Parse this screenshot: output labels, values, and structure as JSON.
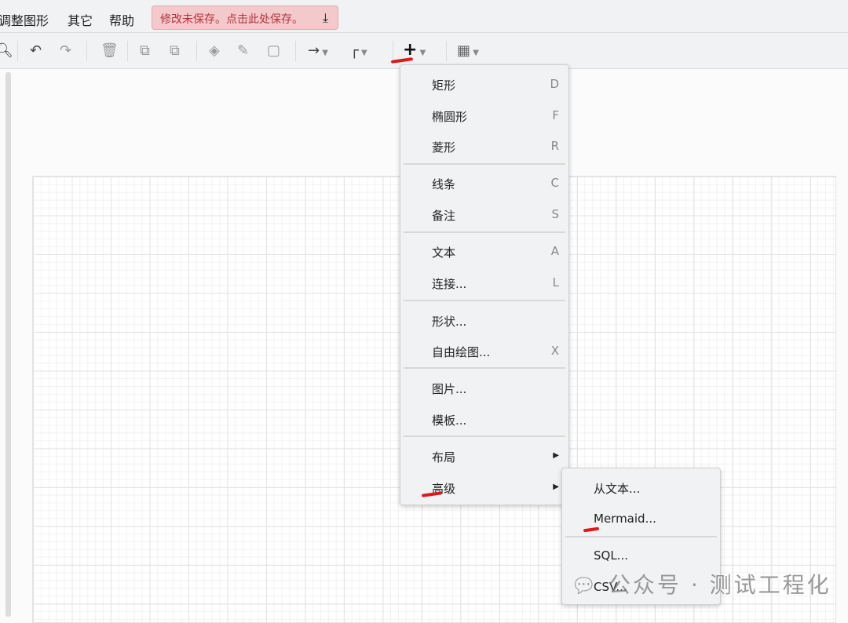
{
  "menubar": {
    "items": [
      "调整图形",
      "其它",
      "帮助"
    ],
    "save_notice": "修改未保存。点击此处保存。"
  },
  "toolbar": {
    "icons": [
      "zoom-out",
      "undo",
      "redo",
      "delete",
      "to-front",
      "to-back",
      "fill-color",
      "line-color",
      "shadow",
      "connection",
      "waypoints",
      "insert",
      "table"
    ]
  },
  "insert_menu": {
    "groups": [
      [
        {
          "label": "矩形",
          "key": "D"
        },
        {
          "label": "椭圆形",
          "key": "F"
        },
        {
          "label": "菱形",
          "key": "R"
        }
      ],
      [
        {
          "label": "线条",
          "key": "C"
        },
        {
          "label": "备注",
          "key": "S"
        }
      ],
      [
        {
          "label": "文本",
          "key": "A"
        },
        {
          "label": "连接...",
          "key": "L"
        }
      ],
      [
        {
          "label": "形状...",
          "key": ""
        },
        {
          "label": "自由绘图...",
          "key": "X"
        }
      ],
      [
        {
          "label": "图片...",
          "key": ""
        },
        {
          "label": "模板...",
          "key": ""
        }
      ],
      [
        {
          "label": "布局",
          "key": ""
        },
        {
          "label": "高级",
          "key": ""
        }
      ]
    ]
  },
  "advanced_submenu": {
    "items": [
      {
        "label": "从文本..."
      },
      {
        "label": "Mermaid..."
      },
      {
        "label": "SQL..."
      },
      {
        "label": "CSV..."
      }
    ]
  },
  "watermark": "公众号 · 测试工程化",
  "colors": {
    "annotation": "#e01818",
    "save_bg": "#f3c9cb"
  }
}
